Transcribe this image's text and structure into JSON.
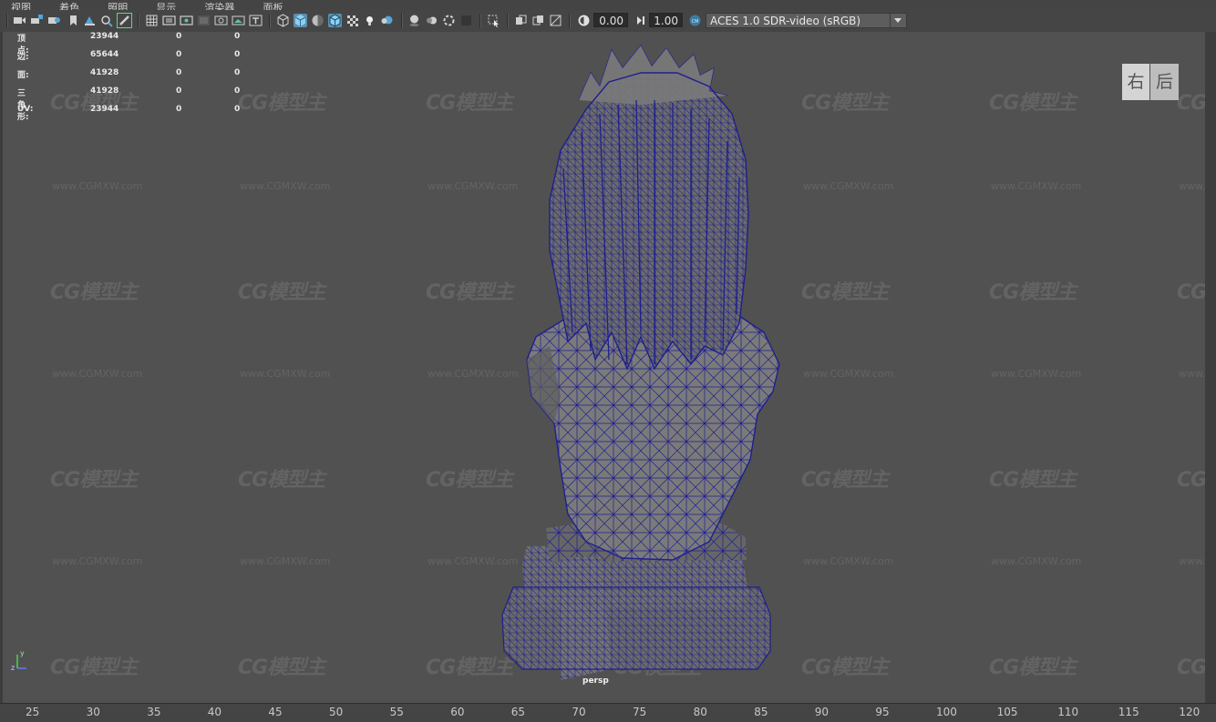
{
  "menu": [
    "视图",
    "着色",
    "照明",
    "显示",
    "渲染器",
    "面板"
  ],
  "toolbar": {
    "icons": [
      "camera-icon",
      "camera-lock-icon",
      "camera-bookmark-icon",
      "bookmark-icon",
      "image-plane-icon",
      "2d-pan-zoom-icon",
      "grease-pencil-icon",
      "grid-icon",
      "film-gate-icon",
      "resolution-gate-icon",
      "gate-mask-icon",
      "field-chart-icon",
      "safe-action-icon",
      "wireframe-icon",
      "smooth-shade-icon",
      "default-material-icon",
      "wireframe-on-shaded-icon",
      "textured-icon",
      "use-all-lights-icon",
      "shadows-icon",
      "screen-space-ao-icon",
      "motion-blur-icon",
      "anti-aliasing-icon",
      "depth-of-field-icon",
      "isolate-select-icon",
      "xray-icon",
      "xray-active-icon",
      "xray-joints-icon",
      "exposure-icon",
      "gamma-icon",
      "color-management-icon"
    ],
    "exposure_value": "0.00",
    "gamma_value": "1.00",
    "color_space": "ACES 1.0 SDR-video (sRGB)",
    "active_color": "#5b8fb0"
  },
  "hud": [
    {
      "label": "顶点:",
      "v1": "23944",
      "v2": "0",
      "v3": "0"
    },
    {
      "label": "边:",
      "v1": "65644",
      "v2": "0",
      "v3": "0"
    },
    {
      "label": "面:",
      "v1": "41928",
      "v2": "0",
      "v3": "0"
    },
    {
      "label": "三角形:",
      "v1": "41928",
      "v2": "0",
      "v3": "0"
    },
    {
      "label": "UV:",
      "v1": "23944",
      "v2": "0",
      "v3": "0"
    }
  ],
  "viewcube": {
    "right": "右",
    "back": "后"
  },
  "camera_label": "persp",
  "watermark": {
    "logo": "CG模型主",
    "url": "www.CGMXW.com"
  },
  "axis": {
    "y": "y",
    "z": "z"
  },
  "timeline_ticks": [
    "25",
    "30",
    "35",
    "40",
    "45",
    "50",
    "55",
    "60",
    "65",
    "70",
    "75",
    "80",
    "85",
    "90",
    "95",
    "100",
    "105",
    "110",
    "115",
    "120"
  ],
  "colors": {
    "viewport_bg": "#515151",
    "wire": "#1f1f8f",
    "mesh_fill": "#6e6e6e"
  }
}
